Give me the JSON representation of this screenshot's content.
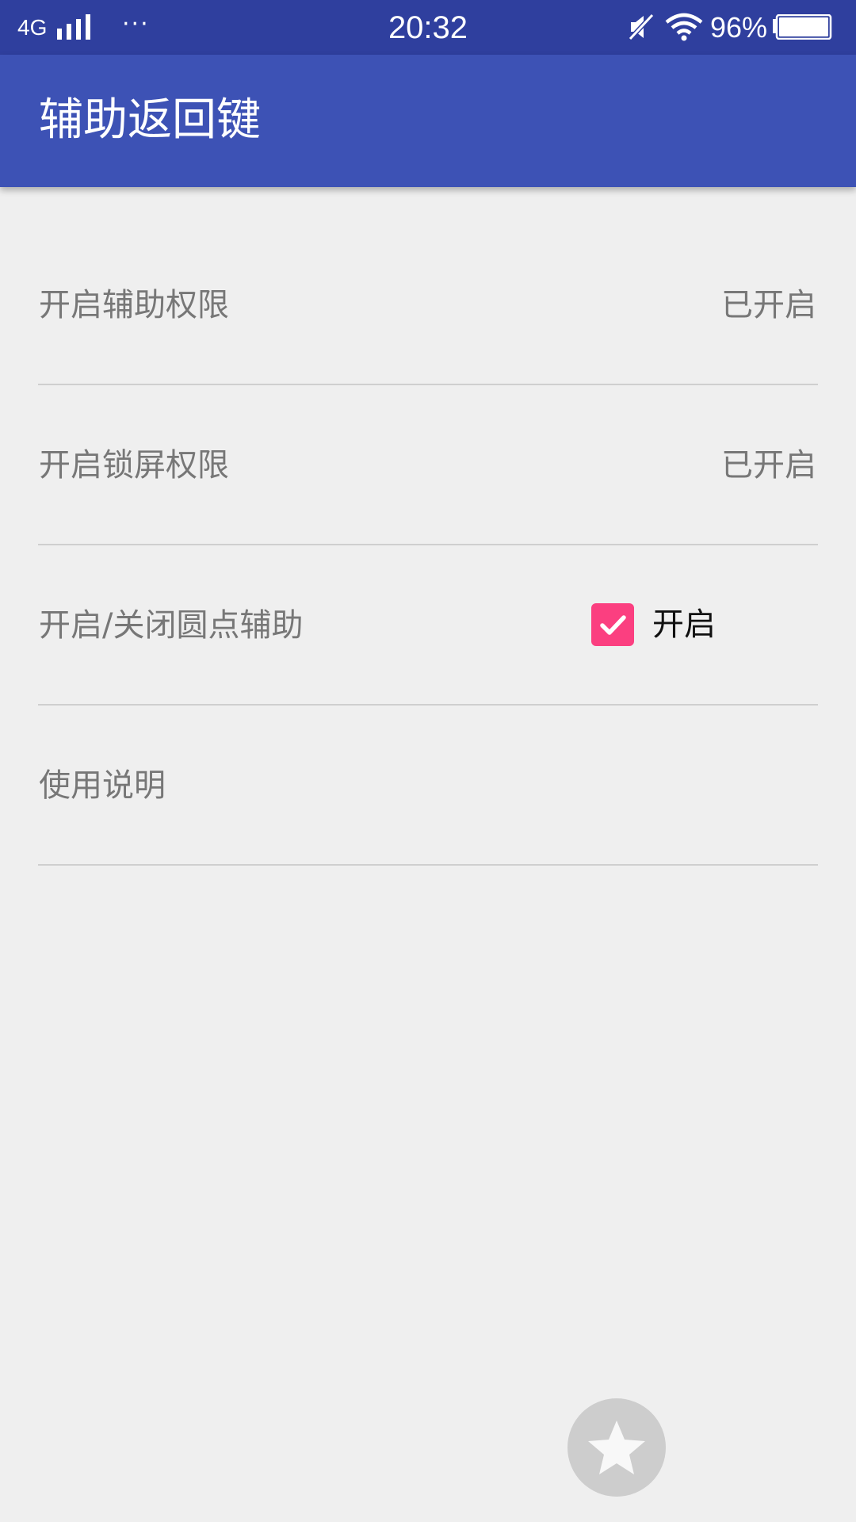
{
  "status_bar": {
    "network": "4G",
    "more": "···",
    "time": "20:32",
    "battery_percent": "96%",
    "icons": [
      "signal-icon",
      "mute-icon",
      "wifi-icon",
      "battery-icon"
    ]
  },
  "app_bar": {
    "title": "辅助返回键",
    "color": "#3d52b5"
  },
  "settings": {
    "items": [
      {
        "label": "开启辅助权限",
        "value": "已开启"
      },
      {
        "label": "开启锁屏权限",
        "value": "已开启"
      },
      {
        "label": "开启/关闭圆点辅助",
        "checkbox_checked": true,
        "checkbox_label": "开启"
      },
      {
        "label": "使用说明"
      }
    ]
  },
  "floating_button": {
    "icon": "star-icon"
  },
  "colors": {
    "status_bar": "#2f3f9e",
    "checkbox": "#fb3f80",
    "background": "#efefef"
  }
}
